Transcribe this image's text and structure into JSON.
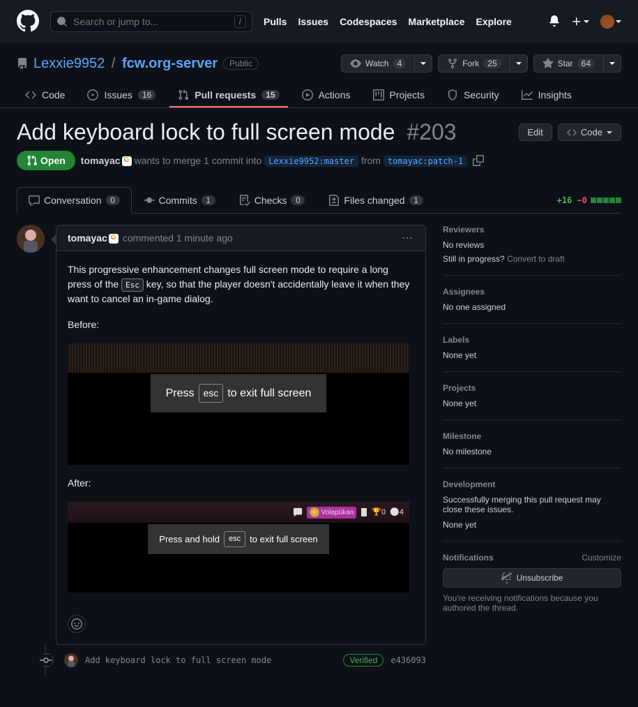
{
  "topnav": {
    "search_placeholder": "Search or jump to...",
    "slash": "/",
    "links": [
      "Pulls",
      "Issues",
      "Codespaces",
      "Marketplace",
      "Explore"
    ]
  },
  "repo": {
    "owner": "Lexxie9952",
    "name": "fcw.org-server",
    "visibility": "Public",
    "watch_label": "Watch",
    "watch_count": "4",
    "fork_label": "Fork",
    "fork_count": "25",
    "star_label": "Star",
    "star_count": "64"
  },
  "tabs": {
    "code": "Code",
    "issues": "Issues",
    "issues_count": "16",
    "pulls": "Pull requests",
    "pulls_count": "15",
    "actions": "Actions",
    "projects": "Projects",
    "security": "Security",
    "insights": "Insights"
  },
  "pr": {
    "title": "Add keyboard lock to full screen mode",
    "number": "#203",
    "edit": "Edit",
    "code": "Code",
    "state": "Open",
    "author": "tomayac",
    "merge_text_1": "wants to merge 1 commit into",
    "base_branch": "Lexxie9952:master",
    "merge_text_2": "from",
    "head_branch": "tomayac:patch-1"
  },
  "subtabs": {
    "conversation": "Conversation",
    "conversation_count": "0",
    "commits": "Commits",
    "commits_count": "1",
    "checks": "Checks",
    "checks_count": "0",
    "files": "Files changed",
    "files_count": "1",
    "additions": "+16",
    "deletions": "−0"
  },
  "comment": {
    "author": "tomayac",
    "commented": "commented",
    "time": "1 minute ago",
    "body_1a": "This progressive enhancement changes full screen mode to require a long press of the ",
    "body_1_kbd": "Esc",
    "body_1b": " key, so that the player doesn't accidentally leave it when they want to cancel an in-game dialog.",
    "before_label": "Before:",
    "after_label": "After:",
    "hint1a": "Press",
    "hint1k": "esc",
    "hint1b": "to exit full screen",
    "hint2a": "Press and hold",
    "hint2k": "esc",
    "hint2b": "to exit full screen",
    "volapukan": "Volapükan",
    "vol_stat1": "0",
    "vol_stat2": "4"
  },
  "commit": {
    "msg": "Add keyboard lock to full screen mode",
    "verified": "Verified",
    "sha": "e436093"
  },
  "sidebar": {
    "reviewers_title": "Reviewers",
    "no_reviews": "No reviews",
    "still_progress": "Still in progress?",
    "convert_draft": "Convert to draft",
    "assignees_title": "Assignees",
    "no_assignees": "No one assigned",
    "labels_title": "Labels",
    "none_yet": "None yet",
    "projects_title": "Projects",
    "milestone_title": "Milestone",
    "no_milestone": "No milestone",
    "development_title": "Development",
    "dev_text": "Successfully merging this pull request may close these issues.",
    "notifications_title": "Notifications",
    "customize": "Customize",
    "unsubscribe": "Unsubscribe",
    "notif_reason": "You're receiving notifications because you authored the thread."
  }
}
